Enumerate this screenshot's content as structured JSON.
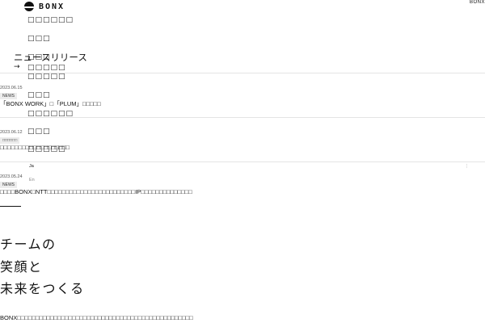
{
  "header": {
    "logo_text": "BONX",
    "top_right": "BONX"
  },
  "nav": {
    "items": [
      "□□□□□□",
      "□□□",
      "□□□",
      "□□□□□",
      "□□□□□",
      "□□□",
      "□□□□□□",
      "□□□",
      "□□□□□"
    ],
    "lang_ja": "Ja",
    "lang_en": "En"
  },
  "news": {
    "title": "ニュースリリース",
    "arrow": "→",
    "items": [
      {
        "date": "2023.06.15",
        "badge": "NEWS",
        "text": "「BONX WORK」□「PLUM」□□□□□"
      },
      {
        "date": "2023.06.12",
        "badge": "□□□□□□",
        "text": "□□□□□□□□□□□□□□□□□□□"
      },
      {
        "date": "2023.05.24",
        "badge": "NEWS",
        "text": "□□□□BONX□NTT□□□□□□□□□□□□□□□□□□□□□□□□IP□□□□□□□□□□□□□□"
      }
    ]
  },
  "hero": {
    "lines": [
      "チームの",
      "笑顔と",
      "未来をつくる"
    ]
  },
  "footer_text": "BONX□□□□□□□□□□□□□□□□□□□□□□□□□□□□□□□□□□□□□□□□□□□□□□□□"
}
